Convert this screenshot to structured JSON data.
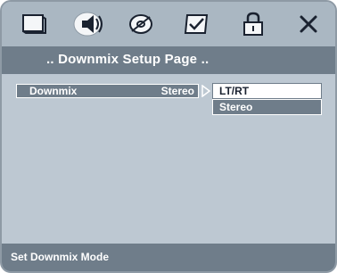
{
  "tabs": [
    {
      "icon": "monitor-icon"
    },
    {
      "icon": "speaker-icon"
    },
    {
      "icon": "disc-icon"
    },
    {
      "icon": "checkmark-icon"
    },
    {
      "icon": "lock-icon"
    },
    {
      "icon": "close-icon"
    }
  ],
  "page_title": ".. Downmix Setup Page ..",
  "setting": {
    "label": "Downmix",
    "value": "Stereo"
  },
  "options": [
    "LT/RT",
    "Stereo"
  ],
  "status": "Set Downmix Mode",
  "colors": {
    "frame": "#bdc8d2",
    "tab_bar": "#aab7c2",
    "title_bar": "#6f7d8a",
    "highlight": "#ffffff",
    "text_dark": "#1a2230"
  }
}
